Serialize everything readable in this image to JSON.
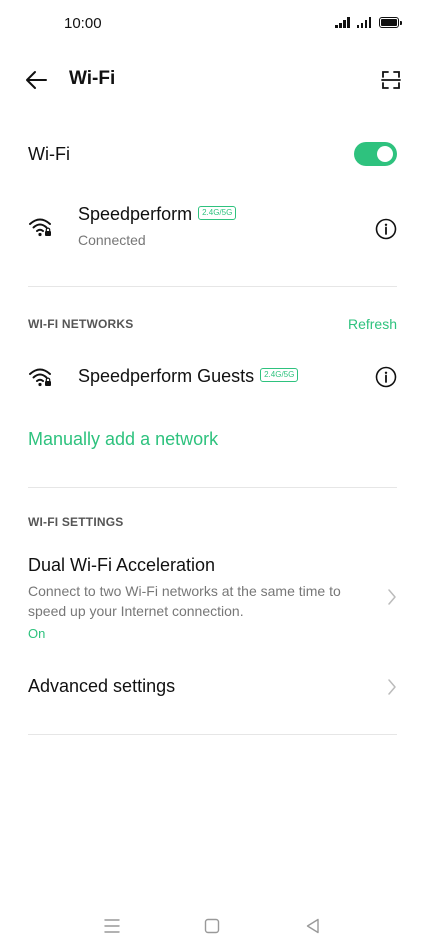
{
  "status_bar": {
    "time": "10:00"
  },
  "app_bar": {
    "title": "Wi-Fi"
  },
  "wifi_toggle": {
    "label": "Wi-Fi",
    "enabled": true
  },
  "connected_network": {
    "name": "Speedperform",
    "band": "2.4G/5G",
    "status": "Connected"
  },
  "networks_section": {
    "header": "WI-FI NETWORKS",
    "refresh_label": "Refresh",
    "items": [
      {
        "name": "Speedperform Guests",
        "band": "2.4G/5G"
      }
    ],
    "manual_add_label": "Manually add a network"
  },
  "settings_section": {
    "header": "WI-FI SETTINGS",
    "dual_wifi": {
      "title": "Dual Wi-Fi Acceleration",
      "description": "Connect to two Wi-Fi networks at the same time to speed up your Internet connection.",
      "value": "On"
    },
    "advanced": {
      "title": "Advanced settings"
    }
  },
  "icons": {
    "back": "arrow-left-icon",
    "scan": "qr-scan-icon",
    "wifi": "wifi-lock-icon",
    "info": "info-icon",
    "chevron": "chevron-right-icon",
    "nav_menu": "menu-icon",
    "nav_home": "home-square-icon",
    "nav_back": "back-triangle-icon"
  },
  "colors": {
    "accent": "#2ec27e",
    "text": "#111111",
    "secondary": "#777777",
    "divider": "#e6e6e6"
  }
}
